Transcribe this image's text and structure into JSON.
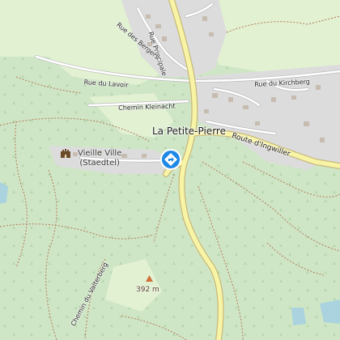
{
  "map": {
    "colors": {
      "forest": "#cfe6c6",
      "meadow": "#e2f1d2",
      "urban": "#dcdcdc",
      "major_road": "#f7f4a6",
      "major_road_casing": "#c9b97a",
      "minor_road": "#ffffff",
      "path": "#b07a5a",
      "water": "#aad3df",
      "marker": "#1e88e5"
    },
    "labels": {
      "rue_principale": "Rue Principale",
      "rue_des_bergers": "Rue des Bergers",
      "rue_du_lavoir": "Rue du Lavoir",
      "rue_du_kirchberg": "Rue du Kirchberg",
      "chemin_kleinacht": "Chemin Kleinacht",
      "la_petite_pierre": "La Petite-Pierre",
      "route_d_ingwiller": "Route d'Ingwiller",
      "vieille_ville_line1": "Vieille Ville",
      "vieille_ville_line2": "(Staedtel)",
      "chemin_du_valterberg": "Chemin du Valterberg",
      "elevation": "392 m"
    },
    "icons": {
      "castle": "castle-icon",
      "location_marker": "directions-marker-icon",
      "peak": "peak-triangle-icon"
    }
  }
}
